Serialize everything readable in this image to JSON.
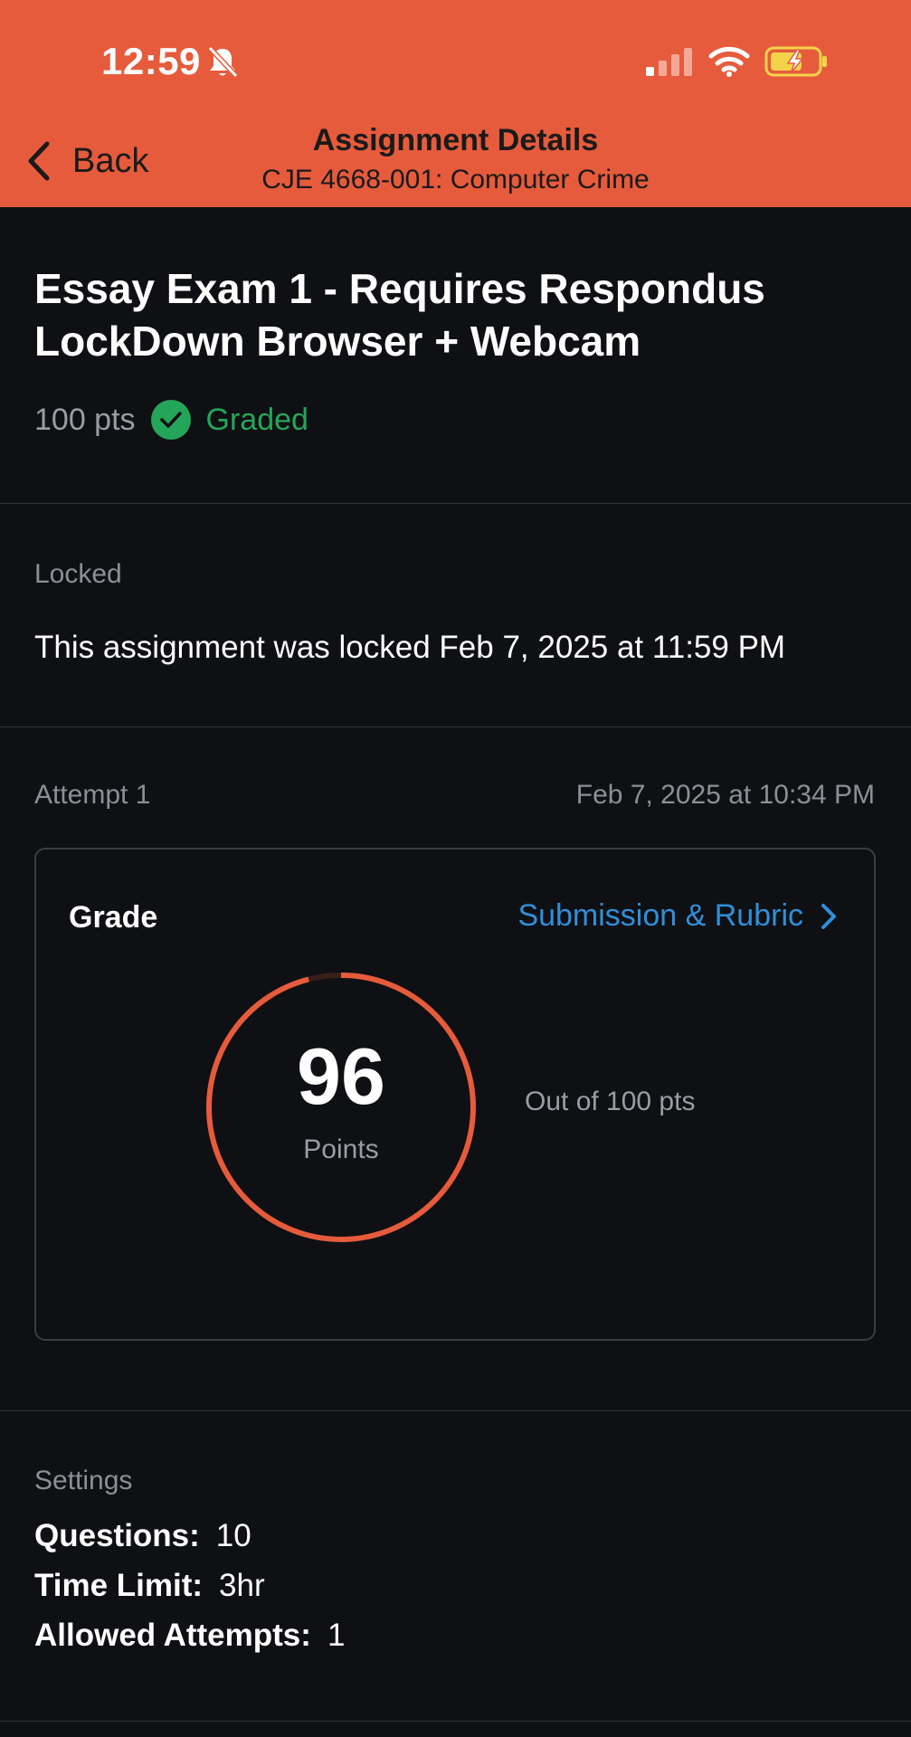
{
  "status_bar": {
    "time": "12:59"
  },
  "header": {
    "back_label": "Back",
    "title": "Assignment Details",
    "subtitle": "CJE 4668-001: Computer Crime",
    "background": "#E65B3C"
  },
  "assignment": {
    "title": "Essay Exam 1 - Requires Respondus LockDown Browser + Webcam",
    "points": "100 pts",
    "status": "Graded",
    "status_color": "#25A55A"
  },
  "lock": {
    "label": "Locked",
    "message": "This assignment was locked Feb 7, 2025 at 11:59 PM"
  },
  "attempt": {
    "label": "Attempt 1",
    "date": "Feb 7, 2025 at 10:34 PM"
  },
  "grade": {
    "label": "Grade",
    "link_label": "Submission & Rubric",
    "score": "96",
    "unit": "Points",
    "out_of": "Out of 100 pts",
    "fraction": 0.96,
    "ring_color": "#E65B3C",
    "link_color": "#2F8FDB"
  },
  "settings": {
    "label": "Settings",
    "items": [
      {
        "key": "Questions:",
        "value": "10"
      },
      {
        "key": "Time Limit:",
        "value": "3hr"
      },
      {
        "key": "Allowed Attempts:",
        "value": "1"
      }
    ]
  }
}
